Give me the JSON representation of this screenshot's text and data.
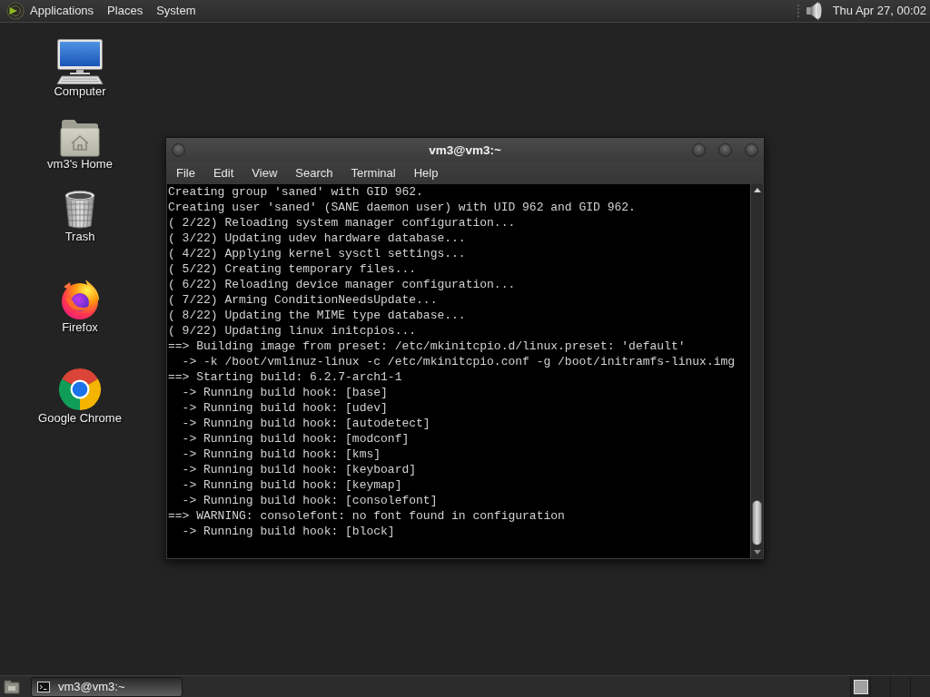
{
  "top_panel": {
    "menus": [
      "Applications",
      "Places",
      "System"
    ],
    "clock": "Thu Apr 27, 00:02"
  },
  "desktop_icons": [
    {
      "kind": "computer",
      "label": "Computer"
    },
    {
      "kind": "home",
      "label": "vm3's Home"
    },
    {
      "kind": "trash",
      "label": "Trash"
    },
    {
      "kind": "firefox",
      "label": "Firefox"
    },
    {
      "kind": "chrome",
      "label": "Google Chrome"
    }
  ],
  "terminal_window": {
    "title": "vm3@vm3:~",
    "menus": [
      "File",
      "Edit",
      "View",
      "Search",
      "Terminal",
      "Help"
    ],
    "lines": [
      "Creating group 'saned' with GID 962.",
      "Creating user 'saned' (SANE daemon user) with UID 962 and GID 962.",
      "( 2/22) Reloading system manager configuration...",
      "( 3/22) Updating udev hardware database...",
      "( 4/22) Applying kernel sysctl settings...",
      "( 5/22) Creating temporary files...",
      "( 6/22) Reloading device manager configuration...",
      "( 7/22) Arming ConditionNeedsUpdate...",
      "( 8/22) Updating the MIME type database...",
      "( 9/22) Updating linux initcpios...",
      "==> Building image from preset: /etc/mkinitcpio.d/linux.preset: 'default'",
      "  -> -k /boot/vmlinuz-linux -c /etc/mkinitcpio.conf -g /boot/initramfs-linux.img",
      "==> Starting build: 6.2.7-arch1-1",
      "  -> Running build hook: [base]",
      "  -> Running build hook: [udev]",
      "  -> Running build hook: [autodetect]",
      "  -> Running build hook: [modconf]",
      "  -> Running build hook: [kms]",
      "  -> Running build hook: [keyboard]",
      "  -> Running build hook: [keymap]",
      "  -> Running build hook: [consolefont]",
      "==> WARNING: consolefont: no font found in configuration",
      "  -> Running build hook: [block]"
    ]
  },
  "bottom_panel": {
    "tasks": [
      {
        "label": "vm3@vm3:~",
        "selected": true
      }
    ]
  }
}
